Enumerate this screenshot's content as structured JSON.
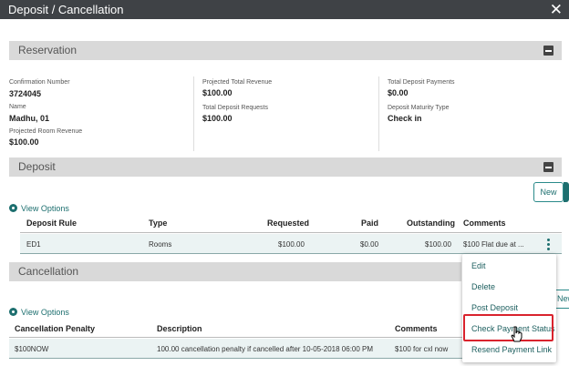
{
  "window": {
    "title": "Deposit / Cancellation"
  },
  "reservation": {
    "header": "Reservation",
    "confirmation_number_label": "Confirmation Number",
    "confirmation_number": "3724045",
    "name_label": "Name",
    "name": "Madhu, 01",
    "projected_room_revenue_label": "Projected Room Revenue",
    "projected_room_revenue": "$100.00",
    "projected_total_revenue_label": "Projected Total Revenue",
    "projected_total_revenue": "$100.00",
    "total_deposit_requests_label": "Total Deposit Requests",
    "total_deposit_requests": "$100.00",
    "total_deposit_payments_label": "Total Deposit Payments",
    "total_deposit_payments": "$0.00",
    "deposit_maturity_type_label": "Deposit Maturity Type",
    "deposit_maturity_type": "Check in"
  },
  "deposit": {
    "header": "Deposit",
    "new_label": "New",
    "view_options": "View Options",
    "columns": [
      "Deposit Rule",
      "Type",
      "Requested",
      "Paid",
      "Outstanding",
      "Comments"
    ],
    "rows": [
      {
        "rule": "ED1",
        "type": "Rooms",
        "requested": "$100.00",
        "paid": "$0.00",
        "outstanding": "$100.00",
        "comments": "$100 Flat due at ..."
      }
    ]
  },
  "cancellation": {
    "header": "Cancellation",
    "new_label": "New",
    "view_options": "View Options",
    "columns": [
      "Cancellation Penalty",
      "Description",
      "Comments"
    ],
    "rows": [
      {
        "penalty": "$100NOW",
        "description": "100.00 cancellation penalty if cancelled after 10-05-2018 06:00 PM",
        "comments": "$100 for cxl now"
      }
    ]
  },
  "context_menu": {
    "items": [
      "Edit",
      "Delete",
      "Post Deposit",
      "Check Payment Status",
      "Resend Payment Link"
    ],
    "highlighted_index": 3
  },
  "colors": {
    "accent": "#1d6f6f",
    "titlebar": "#3f4246",
    "highlight": "#d9232d"
  }
}
